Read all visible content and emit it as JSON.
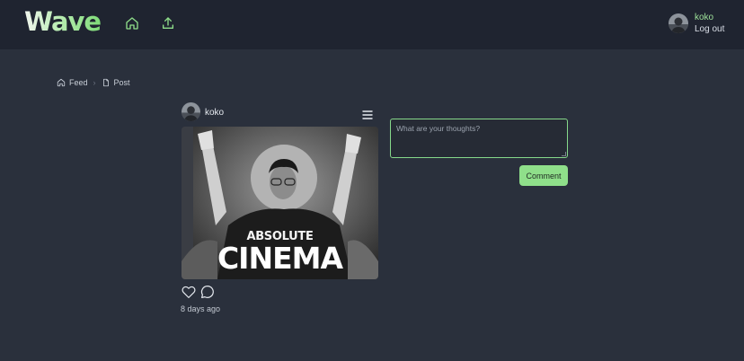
{
  "app": {
    "logo_text": "Wave"
  },
  "navbar": {
    "home_icon": "home-icon",
    "upload_icon": "upload-icon",
    "user": {
      "username": "koko",
      "logout_label": "Log out"
    }
  },
  "breadcrumb": {
    "items": [
      {
        "label": "Feed",
        "icon": "home-icon"
      },
      {
        "label": "Post",
        "icon": "file-icon"
      }
    ]
  },
  "post": {
    "author": "koko",
    "image_caption_small": "ABSOLUTE",
    "image_caption_large": "CINEMA",
    "time_ago": "8 days ago"
  },
  "comment": {
    "placeholder": "What are your thoughts?",
    "value": "",
    "submit_label": "Comment"
  },
  "colors": {
    "background": "#2a303c",
    "navbar": "#1f2430",
    "accent": "#8fdf8a",
    "username": "#9ee29a"
  }
}
